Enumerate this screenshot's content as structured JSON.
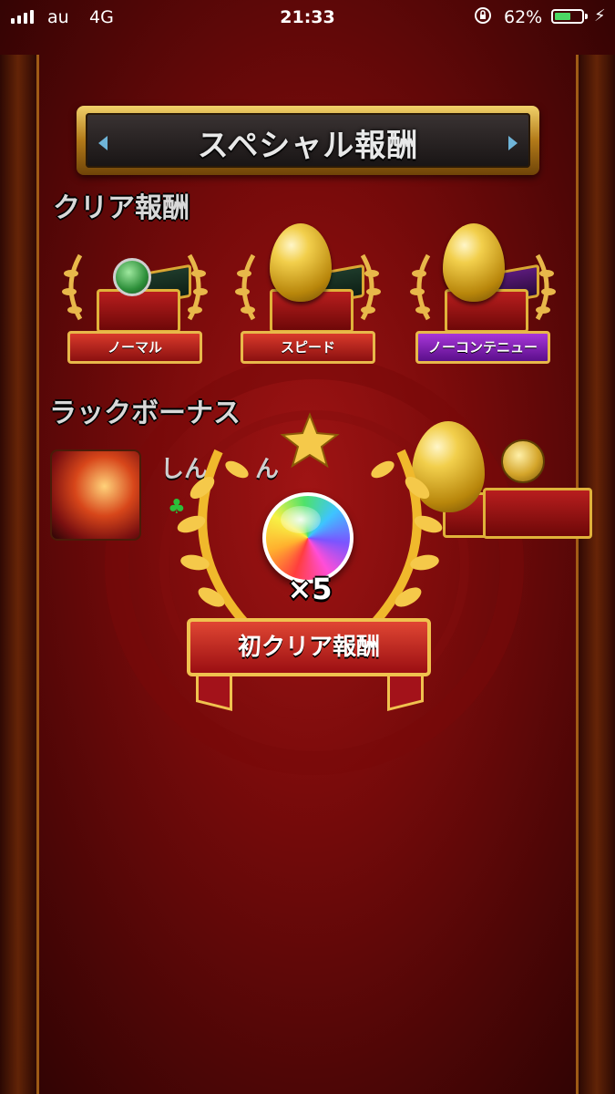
{
  "status_bar": {
    "carrier": "au",
    "network": "4G",
    "time": "21:33",
    "battery_percent": "62%",
    "battery_level": 0.62,
    "icons": [
      "signal-icon",
      "rotation-lock-icon",
      "battery-icon",
      "charging-icon"
    ]
  },
  "title": "スペシャル報酬",
  "clear_rewards": {
    "heading": "クリア報酬",
    "items": [
      {
        "label": "ノーマル",
        "ribbon_color": "#c4231f",
        "item": "green-orb"
      },
      {
        "label": "スピード",
        "ribbon_color": "#c4231f",
        "item": "gold-egg"
      },
      {
        "label": "ノーコンテニュー",
        "ribbon_color": "#8a23c4",
        "item": "gold-egg"
      }
    ]
  },
  "luck_bonus": {
    "heading": "ラックボーナス",
    "player_name": "しん　　ん",
    "rewards": [
      "gold-egg",
      "gold-coin"
    ]
  },
  "popup": {
    "item": "rainbow-orb",
    "count_text": "×5",
    "ribbon_label": "初クリア報酬"
  },
  "colors": {
    "background": "#7a0b0b",
    "gold": "#e0b23a",
    "ribbon_red": "#c4231f",
    "ribbon_purple": "#8a23c4"
  }
}
